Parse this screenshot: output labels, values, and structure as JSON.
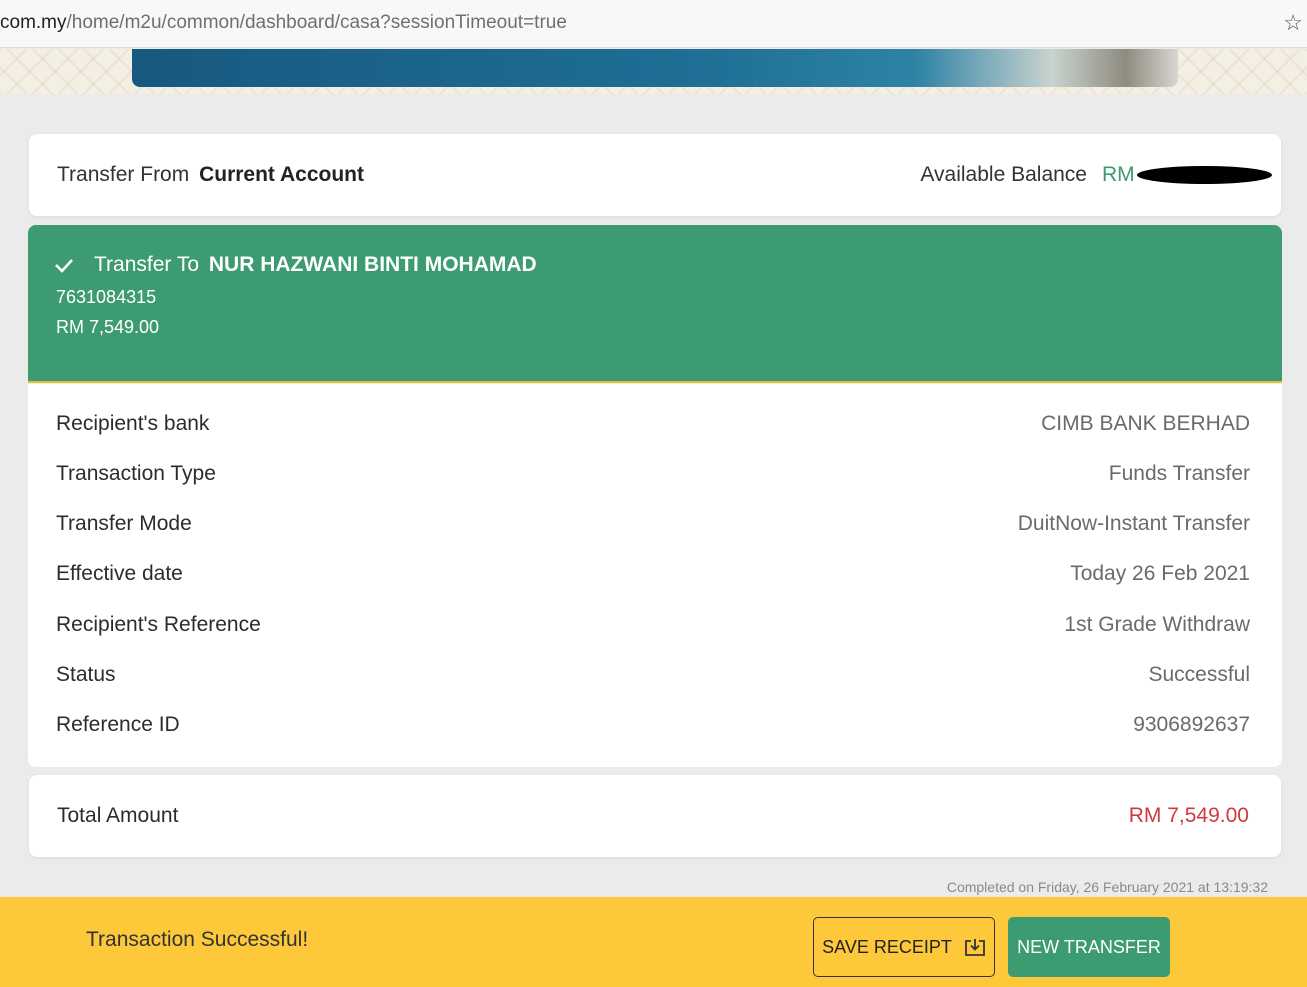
{
  "browser": {
    "url_host": "com.my",
    "url_path": "/home/m2u/common/dashboard/casa?sessionTimeout=true"
  },
  "from": {
    "label": "Transfer From",
    "account": "Current Account",
    "balance_label": "Available Balance",
    "balance_value": "RM"
  },
  "to": {
    "label": "Transfer To",
    "name": "NUR HAZWANI BINTI MOHAMAD",
    "account_number": "7631084315",
    "amount": "RM 7,549.00"
  },
  "details": [
    {
      "key": "Recipient's bank",
      "value": "CIMB BANK BERHAD"
    },
    {
      "key": "Transaction Type",
      "value": "Funds Transfer"
    },
    {
      "key": "Transfer Mode",
      "value": "DuitNow-Instant Transfer"
    },
    {
      "key": "Effective date",
      "value": "Today 26 Feb 2021"
    },
    {
      "key": "Recipient's Reference",
      "value": "1st Grade Withdraw"
    },
    {
      "key": "Status",
      "value": "Successful"
    },
    {
      "key": "Reference ID",
      "value": "9306892637"
    }
  ],
  "total": {
    "label": "Total Amount",
    "value": "RM 7,549.00"
  },
  "completed_text": "Completed on Friday, 26 February 2021 at 13:19:32",
  "footer": {
    "message": "Transaction Successful!",
    "save_label": "SAVE RECEIPT",
    "new_label": "NEW TRANSFER"
  },
  "colors": {
    "brand_green": "#3c9b70",
    "footer_yellow": "#fec83b",
    "amount_red": "#d0393e"
  },
  "icons": {
    "check": "check-icon",
    "download": "download-icon",
    "bookmark": "star-icon"
  }
}
